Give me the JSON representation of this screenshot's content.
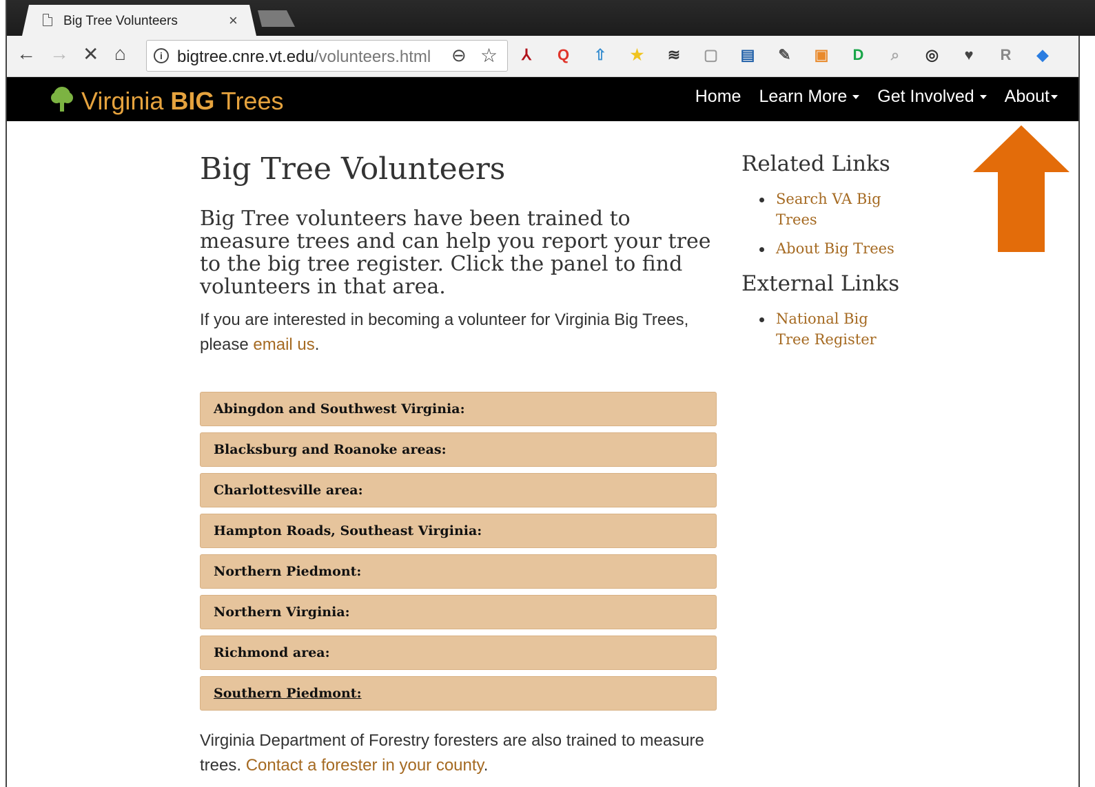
{
  "browser": {
    "tab_title": "Big Tree Volunteers",
    "tab_close": "×",
    "url_host": "bigtree.cnre.vt.edu",
    "url_path": "/volunteers.html",
    "back": "←",
    "forward": "→",
    "stop": "✕",
    "home": "⌂",
    "info": "i",
    "zoom": "⊖",
    "star": "☆",
    "extensions": [
      {
        "name": "pdf-icon",
        "glyph": "⅄",
        "color": "#b0121b"
      },
      {
        "name": "q-icon",
        "glyph": "Q",
        "color": "#e0352b"
      },
      {
        "name": "up-arrow-icon",
        "glyph": "⇧",
        "color": "#3a8fd0"
      },
      {
        "name": "star-ext-icon",
        "glyph": "★",
        "color": "#f0c420"
      },
      {
        "name": "layers-icon",
        "glyph": "≋",
        "color": "#333333"
      },
      {
        "name": "square-icon",
        "glyph": "▢",
        "color": "#9a9a9a"
      },
      {
        "name": "book-icon",
        "glyph": "▤",
        "color": "#1f5fa8"
      },
      {
        "name": "eyedropper-icon",
        "glyph": "✎",
        "color": "#555555"
      },
      {
        "name": "image-icon",
        "glyph": "▣",
        "color": "#e98a2c"
      },
      {
        "name": "id-icon",
        "glyph": "D",
        "color": "#1aa64a"
      },
      {
        "name": "magnifier-icon",
        "glyph": "⌕",
        "color": "#aaaaaa"
      },
      {
        "name": "wheel-icon",
        "glyph": "◎",
        "color": "#333333"
      },
      {
        "name": "pocket-icon",
        "glyph": "♥",
        "color": "#444444"
      },
      {
        "name": "r-icon",
        "glyph": "R",
        "color": "#888888"
      },
      {
        "name": "diamond-icon",
        "glyph": "◆",
        "color": "#2a7de1"
      }
    ]
  },
  "site": {
    "brand_prefix": "Virginia ",
    "brand_bold": "BIG",
    "brand_suffix": " Trees",
    "brand_color": "#e6a33e",
    "nav": {
      "home": "Home",
      "learn_more": "Learn More",
      "get_involved": "Get Involved",
      "about": "About"
    }
  },
  "main": {
    "title": "Big Tree Volunteers",
    "lead": "Big Tree volunteers have been trained to measure trees and can help you report your tree to the big tree register. Click the panel to find volunteers in that area.",
    "para_prefix": "If you are interested in becoming a volunteer for Virginia Big Trees, please ",
    "para_link": "email us",
    "para_suffix": ".",
    "panels": [
      "Abingdon and Southwest Virginia:",
      "Blacksburg and Roanoke areas:",
      "Charlottesville area:",
      "Hampton Roads, Southeast Virginia:",
      "Northern Piedmont:",
      "Northern Virginia:",
      "Richmond area:",
      "Southern Piedmont:"
    ],
    "footer_prefix": "Virginia Department of Forestry foresters are also trained to measure trees. ",
    "footer_link": "Contact a forester in your county",
    "footer_suffix": "."
  },
  "sidebar": {
    "related_title": "Related Links",
    "related_links": [
      "Search VA Big Trees",
      "About Big Trees"
    ],
    "external_title": "External Links",
    "external_links": [
      "National Big Tree Register"
    ]
  },
  "annotation": {
    "arrow_color": "#e36c0a"
  }
}
